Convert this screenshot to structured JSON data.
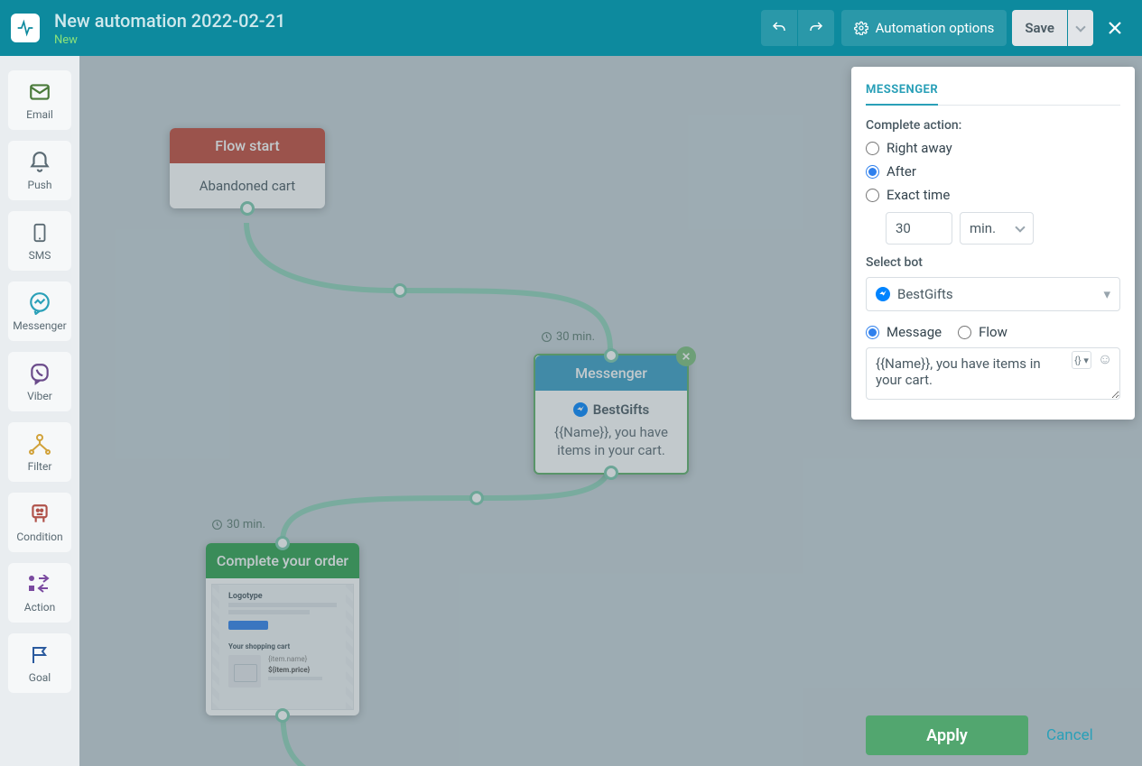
{
  "header": {
    "title": "New automation 2022-02-21",
    "status": "New",
    "automation_options": "Automation options",
    "save": "Save"
  },
  "sidebar": {
    "items": [
      {
        "label": "Email",
        "icon": "email-icon",
        "color": "#4a7a3a"
      },
      {
        "label": "Push",
        "icon": "push-icon",
        "color": "#5a6a73"
      },
      {
        "label": "SMS",
        "icon": "sms-icon",
        "color": "#5a6a73"
      },
      {
        "label": "Messenger",
        "icon": "messenger-icon",
        "color": "#2aa0b8"
      },
      {
        "label": "Viber",
        "icon": "viber-icon",
        "color": "#6a4a8a"
      },
      {
        "label": "Filter",
        "icon": "filter-icon",
        "color": "#d1a23a"
      },
      {
        "label": "Condition",
        "icon": "condition-icon",
        "color": "#b0524a"
      },
      {
        "label": "Action",
        "icon": "action-icon",
        "color": "#7a4aa0"
      },
      {
        "label": "Goal",
        "icon": "goal-icon",
        "color": "#2a5a9e"
      }
    ]
  },
  "canvas": {
    "flow_start": {
      "title": "Flow start",
      "body": "Abandoned cart"
    },
    "messenger": {
      "delay_label": "30 min.",
      "title": "Messenger",
      "bot": "BestGifts",
      "message": "{{Name}}, you have items in your cart."
    },
    "email_node": {
      "delay_label": "30 min.",
      "title": "Complete your order",
      "preview_logo": "Logotype",
      "preview_heading": "Your shopping cart",
      "preview_item_name": "{item.name}",
      "preview_item_price": "${item.price}"
    }
  },
  "panel": {
    "title": "MESSENGER",
    "complete_action_label": "Complete action:",
    "options": {
      "right_away": "Right away",
      "after": "After",
      "exact_time": "Exact time"
    },
    "after_value": "30",
    "after_unit": "min.",
    "select_bot_label": "Select bot",
    "bot_selected": "BestGifts",
    "mode": {
      "message": "Message",
      "flow": "Flow"
    },
    "message_text": "{{Name}}, you have items in your cart.",
    "apply": "Apply",
    "cancel": "Cancel"
  }
}
